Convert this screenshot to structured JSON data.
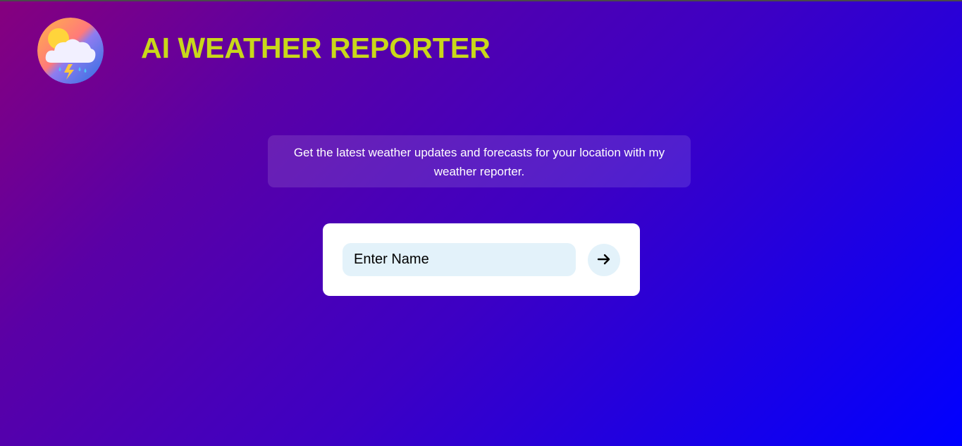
{
  "header": {
    "title": "AI WEATHER REPORTER",
    "logo_icon": "weather-storm-cloud-icon"
  },
  "tagline": {
    "text": "Get the latest weather updates and forecasts for your location with my weather reporter."
  },
  "form": {
    "name_placeholder": "Enter Name",
    "submit_icon": "arrow-right-icon"
  },
  "colors": {
    "title": "#c9d81a",
    "background_start": "#86007e",
    "background_end": "#0000ff",
    "input_background": "#e3f2fa",
    "card_background": "#ffffff"
  }
}
